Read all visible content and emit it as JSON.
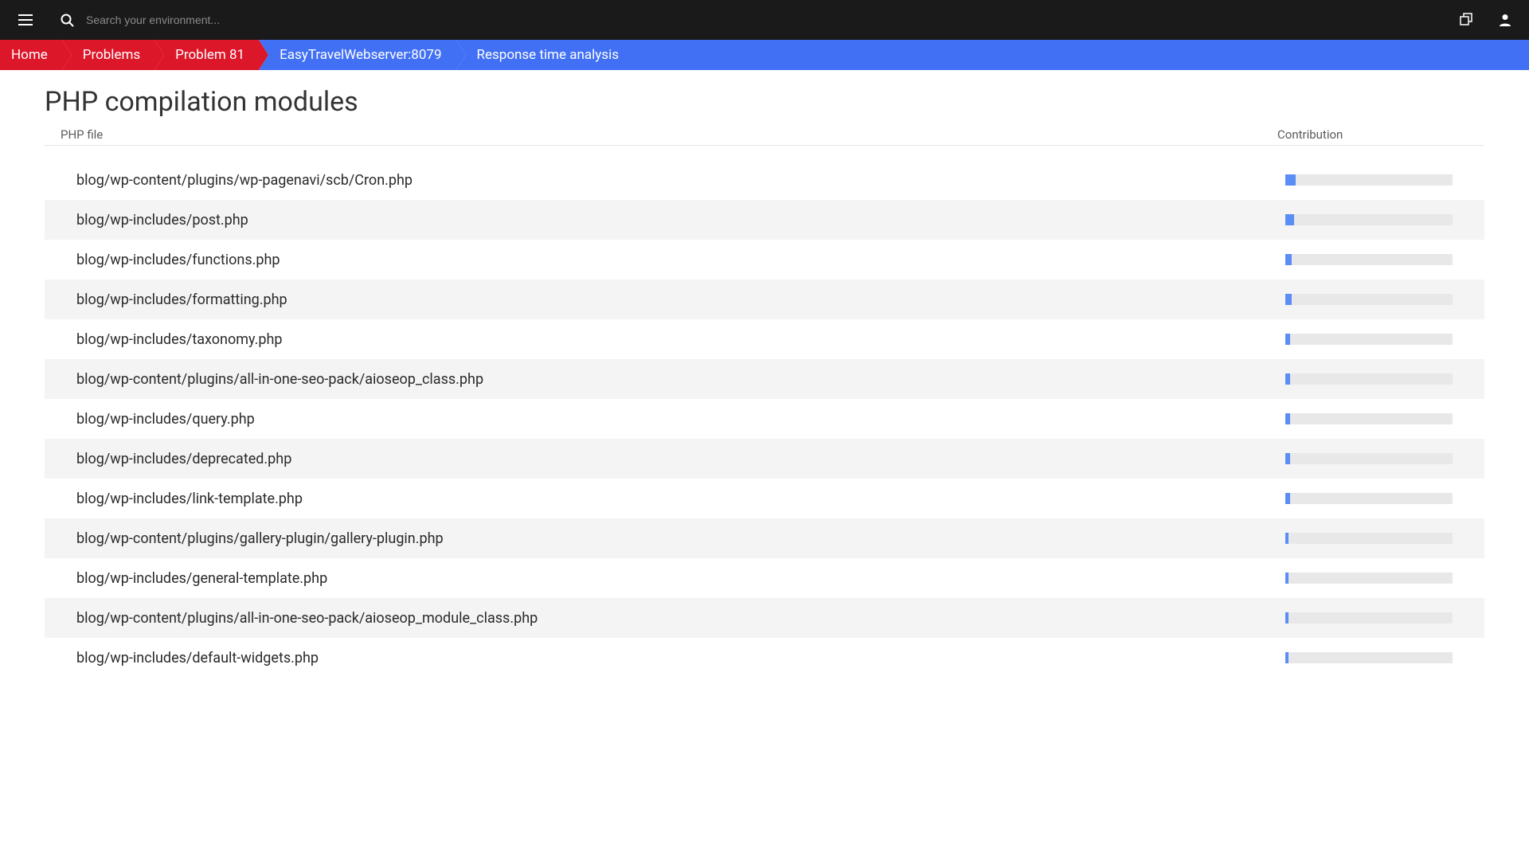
{
  "search": {
    "placeholder": "Search your environment..."
  },
  "breadcrumb": [
    {
      "label": "Home",
      "type": "red"
    },
    {
      "label": "Problems",
      "type": "red"
    },
    {
      "label": "Problem 81",
      "type": "red"
    },
    {
      "label": "EasyTravelWebserver:8079",
      "type": "blue"
    },
    {
      "label": "Response time analysis",
      "type": "blue"
    }
  ],
  "title": "PHP compilation modules",
  "columns": {
    "file": "PHP file",
    "contribution": "Contribution"
  },
  "rows": [
    {
      "file": "blog/wp-content/plugins/wp-pagenavi/scb/Cron.php",
      "pct": 6
    },
    {
      "file": "blog/wp-includes/post.php",
      "pct": 5
    },
    {
      "file": "blog/wp-includes/functions.php",
      "pct": 4
    },
    {
      "file": "blog/wp-includes/formatting.php",
      "pct": 4
    },
    {
      "file": "blog/wp-includes/taxonomy.php",
      "pct": 3
    },
    {
      "file": "blog/wp-content/plugins/all-in-one-seo-pack/aioseop_class.php",
      "pct": 3
    },
    {
      "file": "blog/wp-includes/query.php",
      "pct": 3
    },
    {
      "file": "blog/wp-includes/deprecated.php",
      "pct": 3
    },
    {
      "file": "blog/wp-includes/link-template.php",
      "pct": 3
    },
    {
      "file": "blog/wp-content/plugins/gallery-plugin/gallery-plugin.php",
      "pct": 2
    },
    {
      "file": "blog/wp-includes/general-template.php",
      "pct": 2
    },
    {
      "file": "blog/wp-content/plugins/all-in-one-seo-pack/aioseop_module_class.php",
      "pct": 2
    },
    {
      "file": "blog/wp-includes/default-widgets.php",
      "pct": 2
    }
  ]
}
